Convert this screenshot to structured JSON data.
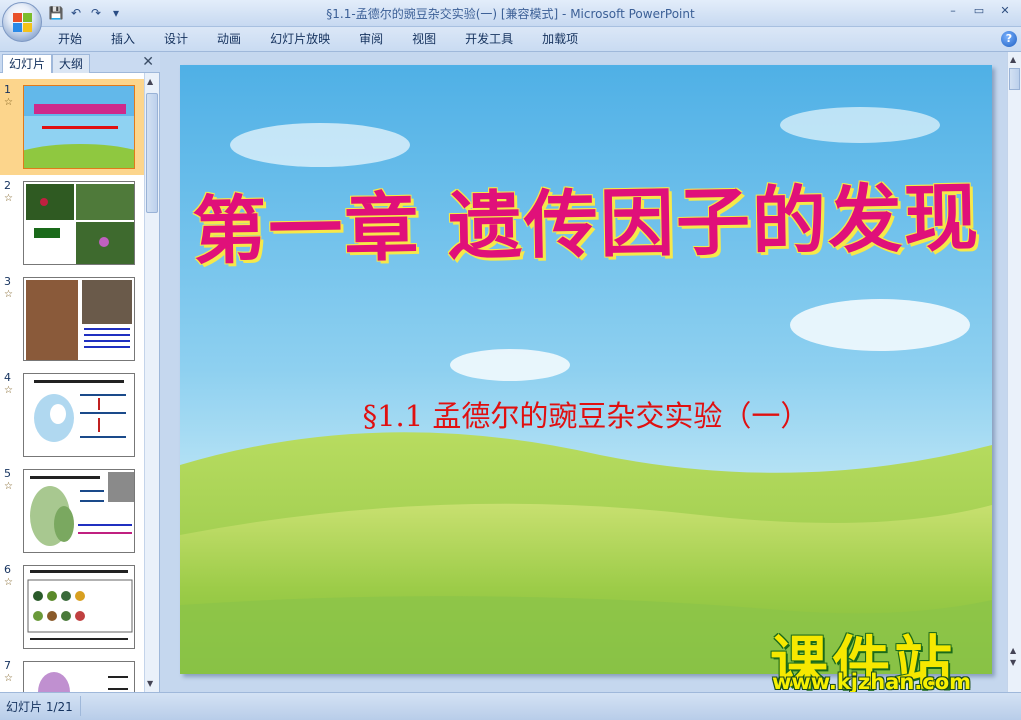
{
  "window": {
    "title": "§1.1-孟德尔的豌豆杂交实验(一) [兼容模式] - Microsoft PowerPoint",
    "controls": [
      "–",
      "▭",
      "✕"
    ]
  },
  "qat": {
    "save": "💾",
    "undo": "↶",
    "redo": "↷",
    "more": "▾"
  },
  "ribbon": {
    "tabs": [
      "开始",
      "插入",
      "设计",
      "动画",
      "幻灯片放映",
      "审阅",
      "视图",
      "开发工具",
      "加载项"
    ],
    "help": "?"
  },
  "left_pane": {
    "tab_slides": "幻灯片",
    "tab_outline": "大纲",
    "close": "✕",
    "thumbnails": [
      {
        "num": "1",
        "star": "☆"
      },
      {
        "num": "2",
        "star": "☆"
      },
      {
        "num": "3",
        "star": "☆"
      },
      {
        "num": "4",
        "star": "☆"
      },
      {
        "num": "5",
        "star": "☆"
      },
      {
        "num": "6",
        "star": "☆"
      },
      {
        "num": "7",
        "star": "☆"
      }
    ]
  },
  "slide": {
    "title": "第一章 遗传因子的发现",
    "subtitle": "§1.1 孟德尔的豌豆杂交实验（一）"
  },
  "watermark": {
    "logo": "课件站",
    "url": "www.kjzhan.com"
  },
  "status": {
    "slide_count": "幻灯片 1/21"
  },
  "colors": {
    "accent": "#e0107a",
    "subtitle": "#e01010",
    "selected_thumb": "#fcd58c"
  }
}
